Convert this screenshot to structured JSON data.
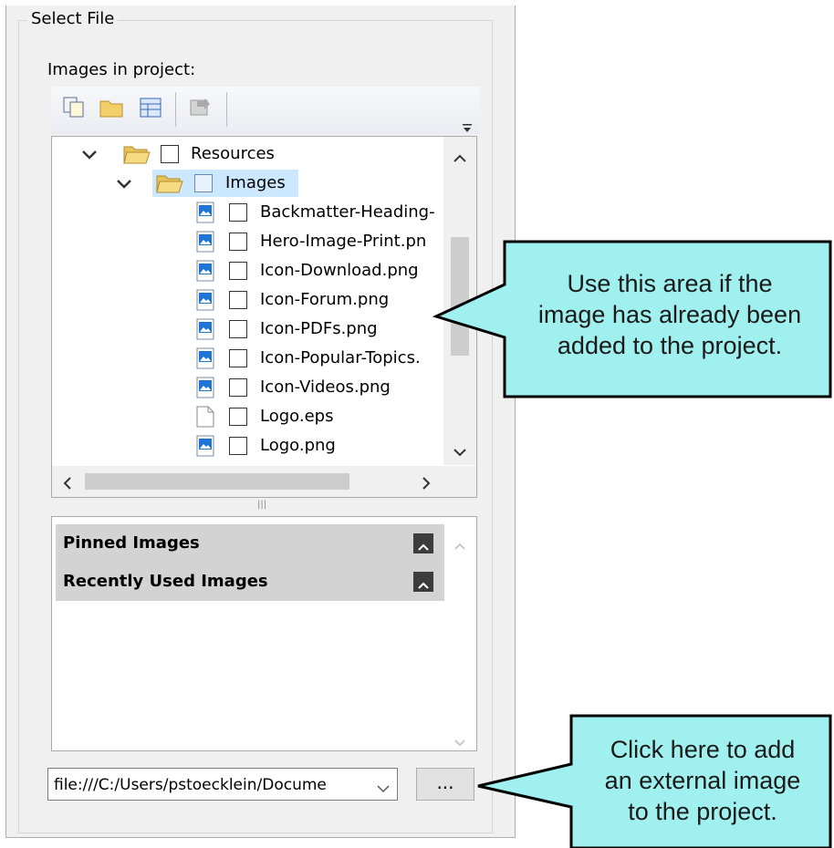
{
  "group": {
    "title": "Select File"
  },
  "images_label": "Images in project:",
  "toolbar": {
    "buttons": [
      {
        "icon": "copy-icon"
      },
      {
        "icon": "folder-icon"
      },
      {
        "icon": "table-icon"
      },
      {
        "icon": "import-icon",
        "disabled": true
      }
    ],
    "overflow_icon": "overflow-chevron-icon"
  },
  "tree": {
    "items": [
      {
        "label": "Resources",
        "type": "folder",
        "expanded": true
      },
      {
        "label": "Images",
        "type": "folder",
        "expanded": true,
        "selected": true
      },
      {
        "label": "Backmatter-Heading-",
        "type": "image"
      },
      {
        "label": "Hero-Image-Print.pn",
        "type": "image"
      },
      {
        "label": "Icon-Download.png",
        "type": "image"
      },
      {
        "label": "Icon-Forum.png",
        "type": "image"
      },
      {
        "label": "Icon-PDFs.png",
        "type": "image"
      },
      {
        "label": "Icon-Popular-Topics.",
        "type": "image"
      },
      {
        "label": "Icon-Videos.png",
        "type": "image"
      },
      {
        "label": "Logo.eps",
        "type": "file"
      },
      {
        "label": "Logo.png",
        "type": "image"
      }
    ]
  },
  "pinned_panel": {
    "sections": [
      {
        "label": "Pinned Images"
      },
      {
        "label": "Recently Used Images"
      }
    ]
  },
  "path_combo": {
    "value": "file:///C:/Users/pstoecklein/Docume"
  },
  "browse_button": {
    "label": "..."
  },
  "callouts": {
    "project_area": {
      "lines": [
        "Use this area if the",
        "image has already been",
        "added to the project."
      ]
    },
    "external": {
      "lines": [
        "Click here to add",
        "an external image",
        "to the project."
      ]
    }
  },
  "colors": {
    "callout_fill": "#a0f0ef",
    "callout_border": "#000000",
    "selection": "#cce8ff"
  }
}
